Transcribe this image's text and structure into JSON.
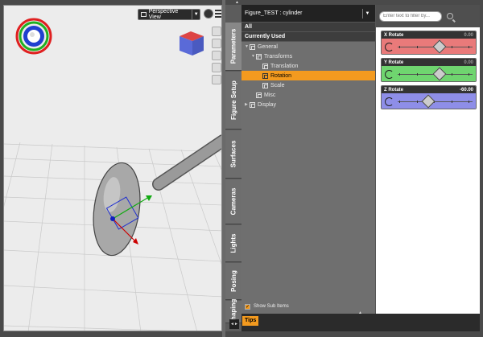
{
  "viewport": {
    "view_label": "Perspective View",
    "view_arrow": "▼"
  },
  "tabs": [
    {
      "label": "Parameters",
      "active": true
    },
    {
      "label": "Figure Setup"
    },
    {
      "label": "Surfaces"
    },
    {
      "label": "Cameras"
    },
    {
      "label": "Lights"
    },
    {
      "label": "Posing"
    },
    {
      "label": "Shaping"
    }
  ],
  "tree": {
    "title": "Figure_TEST : cylinder",
    "dropdown_glyph": "▼",
    "header_all": "All",
    "header_current": "Currently Used",
    "rows": [
      {
        "label": "General",
        "depth": 0,
        "tri": "▼"
      },
      {
        "label": "Transforms",
        "depth": 1,
        "tri": "▼"
      },
      {
        "label": "Translation",
        "depth": 2,
        "tri": ""
      },
      {
        "label": "Rotation",
        "depth": 2,
        "tri": "",
        "selected": true
      },
      {
        "label": "Scale",
        "depth": 2,
        "tri": ""
      },
      {
        "label": "Misc",
        "depth": 1,
        "tri": ""
      },
      {
        "label": "Display",
        "depth": 0,
        "tri": "▶"
      }
    ],
    "show_sub_items": "Show Sub Items",
    "check_glyph": "✓"
  },
  "sliders_panel": {
    "filter_placeholder": "Enter text to filter by...",
    "sliders": [
      {
        "name": "X Rotate",
        "value": "0.00",
        "class": "x",
        "position": 0.5
      },
      {
        "name": "Y Rotate",
        "value": "0.00",
        "class": "y",
        "position": 0.5
      },
      {
        "name": "Z Rotate",
        "value": "-60.00",
        "class": "z",
        "position": 0.35
      }
    ]
  },
  "bottom": {
    "tips_label": "Tips",
    "up_arrow": "▲",
    "corner_glyph": "◄►"
  },
  "colors": {
    "accent": "#f39a1f",
    "x_axis": "#e97a7a",
    "y_axis": "#6fd56f",
    "z_axis": "#8e8ee8"
  }
}
